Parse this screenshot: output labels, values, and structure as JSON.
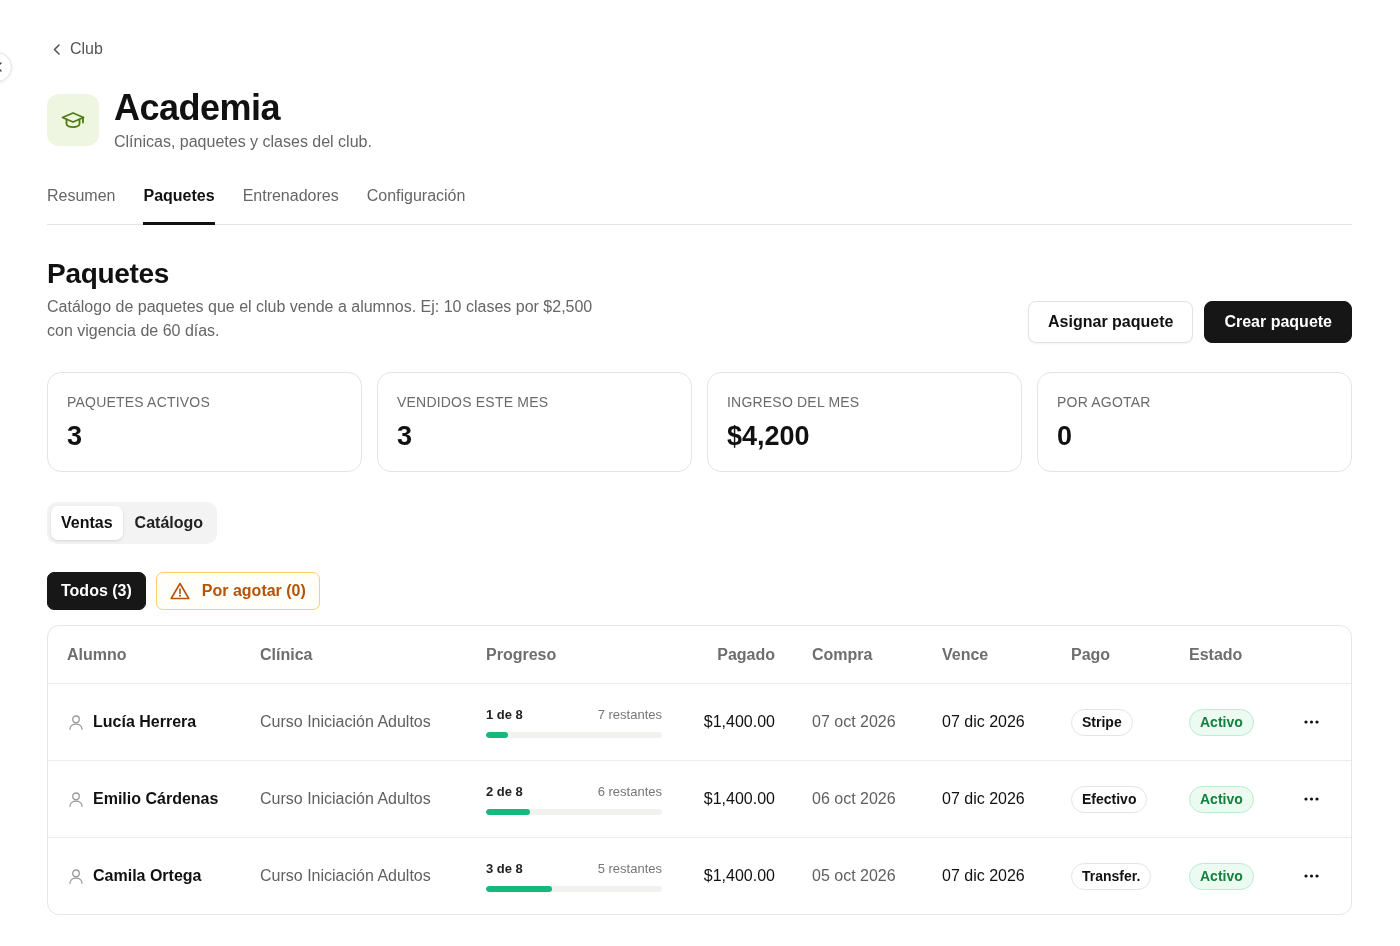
{
  "back_link": {
    "label": "Club"
  },
  "header": {
    "title": "Academia",
    "subtitle": "Clínicas, paquetes y clases del club."
  },
  "tabs": [
    {
      "label": "Resumen",
      "selected": false
    },
    {
      "label": "Paquetes",
      "selected": true
    },
    {
      "label": "Entrenadores",
      "selected": false
    },
    {
      "label": "Configuración",
      "selected": false
    }
  ],
  "section": {
    "title": "Paquetes",
    "description": "Catálogo de paquetes que el club vende a alumnos. Ej: 10 clases por $2,500 con vigencia de 60 días."
  },
  "actions": [
    {
      "label": "Asignar paquete",
      "kind": "secondary"
    },
    {
      "label": "Crear paquete",
      "kind": "primary"
    }
  ],
  "stats": [
    {
      "label": "PAQUETES ACTIVOS",
      "value": "3"
    },
    {
      "label": "VENDIDOS ESTE MES",
      "value": "3"
    },
    {
      "label": "INGRESO DEL MES",
      "value": "$4,200"
    },
    {
      "label": "POR AGOTAR",
      "value": "0"
    }
  ],
  "view_switch": [
    {
      "label": "Ventas",
      "selected": true
    },
    {
      "label": "Catálogo",
      "selected": false
    }
  ],
  "filters": [
    {
      "label": "Todos (3)",
      "selected": true,
      "kind": "all"
    },
    {
      "label": "Por agotar (0)",
      "selected": false,
      "kind": "warning"
    }
  ],
  "table": {
    "columns": [
      "Alumno",
      "Clínica",
      "Progreso",
      "Pagado",
      "Compra",
      "Vence",
      "Pago",
      "Estado"
    ],
    "rows": [
      {
        "student": "Lucía Herrera",
        "clinic": "Curso Iniciación Adultos",
        "progress": {
          "count": "1 de 8",
          "remaining": "7 restantes",
          "level": 0.125
        },
        "paid": "$1,400.00",
        "purchased": "07 oct 2026",
        "expires": "07 dic 2026",
        "payment": "Stripe",
        "status": {
          "label": "Activo",
          "kind": "active"
        }
      },
      {
        "student": "Emilio Cárdenas",
        "clinic": "Curso Iniciación Adultos",
        "progress": {
          "count": "2 de 8",
          "remaining": "6 restantes",
          "level": 0.25
        },
        "paid": "$1,400.00",
        "purchased": "06 oct 2026",
        "expires": "07 dic 2026",
        "payment": "Efectivo",
        "status": {
          "label": "Activo",
          "kind": "active"
        }
      },
      {
        "student": "Camila Ortega",
        "clinic": "Curso Iniciación Adultos",
        "progress": {
          "count": "3 de 8",
          "remaining": "5 restantes",
          "level": 0.375
        },
        "paid": "$1,400.00",
        "purchased": "05 oct 2026",
        "expires": "07 dic 2026",
        "payment": "Transfer.",
        "status": {
          "label": "Activo",
          "kind": "active"
        }
      }
    ]
  }
}
